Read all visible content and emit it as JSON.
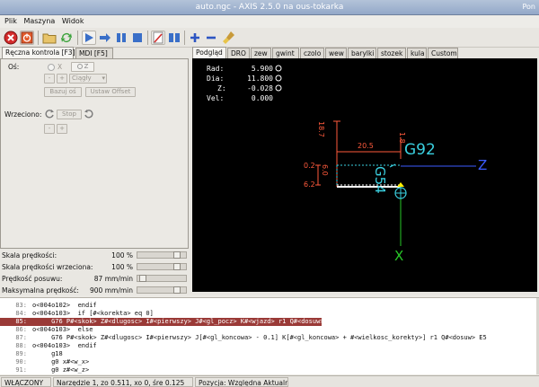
{
  "window": {
    "title": "auto.ngc - AXIS 2.5.0 na ous-tokarka",
    "user_label": "Pon"
  },
  "menu": [
    "Plik",
    "Maszyna",
    "Widok"
  ],
  "toolbar": {
    "icons": [
      "estop-icon",
      "power-icon",
      "open-file-icon",
      "reload-icon",
      "run-icon",
      "step-icon",
      "pause-icon",
      "stop-icon",
      "block-delete-icon",
      "optional-stop-icon",
      "zoom-in-icon",
      "zoom-out-icon",
      "clear-plot-icon"
    ]
  },
  "left_tabs": [
    "Ręczna kontrola [F3]",
    "MDI [F5]"
  ],
  "manual": {
    "axis_label": "Oś:",
    "axis_x": "X",
    "axis_z": "Z",
    "jog_minus": "-",
    "jog_plus": "+",
    "jog_mode": "Ciągły",
    "home_button": "Bazuj oś",
    "offset_button": "Ustaw Offset",
    "spindle_label": "Wrzeciono:",
    "spindle_stop": "Stop",
    "spindle_minus": "-",
    "spindle_plus": "+"
  },
  "sliders": [
    {
      "label": "Skala prędkości:",
      "value": "100 %",
      "fraction": 0.88
    },
    {
      "label": "Skala prędkości wrzeciona:",
      "value": "100 %",
      "fraction": 0.88
    },
    {
      "label": "Prędkość posuwu:",
      "value": "87 mm/min",
      "fraction": 0.05
    },
    {
      "label": "Maksymalna prędkość:",
      "value": "900 mm/min",
      "fraction": 0.88
    }
  ],
  "right_tabs": [
    "Podgląd",
    "DRO",
    "zew",
    "gwint",
    "czolo",
    "wew",
    "barylki",
    "stozek",
    "kula",
    "Custom"
  ],
  "dro": [
    {
      "label": "Rad:",
      "value": "5.900"
    },
    {
      "label": "Dia:",
      "value": "11.800"
    },
    {
      "label": "Z:",
      "value": "-0.028"
    },
    {
      "label": "Vel:",
      "value": "0.000"
    }
  ],
  "preview": {
    "dim_top": "18.7",
    "dim_width": "20.5",
    "dim_small": "1.8",
    "dim_02": "0.2",
    "dim_60": "6.0",
    "dim_62": "6.2",
    "gcode_label": "G92",
    "vertical_label": "G54",
    "axis_z": "Z",
    "axis_x": "X",
    "colors": {
      "red": "#ff5a3c",
      "cyan": "#3ad0e0",
      "blue": "#3c5cff",
      "green": "#28c828",
      "yellow": "#ffee00"
    }
  },
  "code": [
    {
      "n": "83:",
      "t": "o<004o102>  endif"
    },
    {
      "n": "84:",
      "t": "o<004o103>  if [#<korekta> eq 0]"
    },
    {
      "n": "85:",
      "t": "     G76 P#<skok> Z#<dlugosc> I#<pierwszy> J#<gl_pocz> K#<wjazd> r1 Q#<dosuw>",
      "hl": true
    },
    {
      "n": "86:",
      "t": "o<004o103>  else"
    },
    {
      "n": "87:",
      "t": "     G76 P#<skok> Z#<dlugosc> I#<pierwszy> J[#<gl_koncowa> - 0.1] K[#<gl_koncowa> + #<wielkosc_korekty>] r1 Q#<dosuw> E5"
    },
    {
      "n": "88:",
      "t": "o<004o103>  endif"
    },
    {
      "n": "89:",
      "t": "     g18"
    },
    {
      "n": "90:",
      "t": "     g0 x#<w_x>"
    },
    {
      "n": "91:",
      "t": "     g0 z#<w_z>"
    }
  ],
  "status": {
    "state": "WŁĄCZONY",
    "tool": "Narzędzie 1, zo 0.511, xo 0, śre 0.125",
    "position": "Pozycja: Względna Aktualna"
  }
}
